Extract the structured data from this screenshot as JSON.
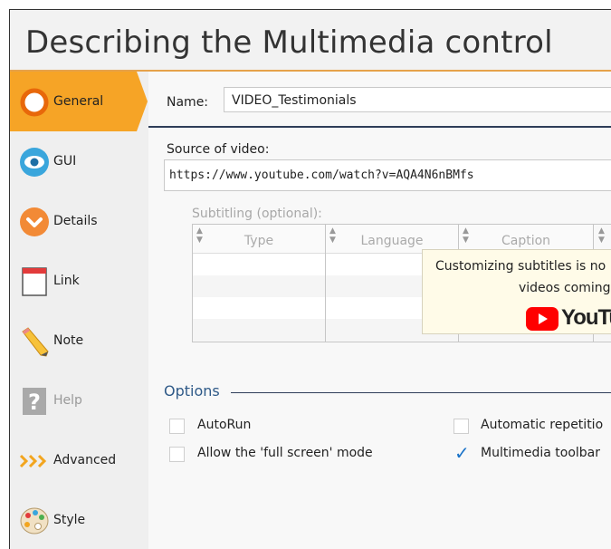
{
  "window": {
    "title": "Describing the Multimedia control"
  },
  "sidebar": {
    "items": [
      {
        "label": "General",
        "icon": "general-circle-icon",
        "active": true
      },
      {
        "label": "GUI",
        "icon": "eye-icon"
      },
      {
        "label": "Details",
        "icon": "details-chevron-icon"
      },
      {
        "label": "Link",
        "icon": "link-window-icon"
      },
      {
        "label": "Note",
        "icon": "pencil-icon"
      },
      {
        "label": "Help",
        "icon": "help-question-icon",
        "disabled": true
      },
      {
        "label": "Advanced",
        "icon": "advanced-chevrons-icon"
      },
      {
        "label": "Style",
        "icon": "palette-icon"
      }
    ]
  },
  "form": {
    "name_label": "Name:",
    "name_value": "VIDEO_Testimonials",
    "source_label": "Source of video:",
    "source_value": "https://www.youtube.com/watch?v=AQA4N6nBMfs",
    "subtitles_label": "Subtitling (optional):",
    "subtitles_columns": [
      "Type",
      "Language",
      "Caption"
    ],
    "tooltip_line1": "Customizing subtitles is no",
    "tooltip_line2": "videos coming",
    "youtube_text": "YouTu"
  },
  "options": {
    "title": "Options",
    "checkboxes": [
      {
        "label": "AutoRun",
        "checked": false
      },
      {
        "label": "Automatic repetitio",
        "checked": false
      },
      {
        "label": "Allow the 'full screen' mode",
        "checked": false
      },
      {
        "label": "Multimedia toolbar",
        "checked": true
      }
    ]
  },
  "colors": {
    "accent": "#f6a426",
    "link": "#2f5a88",
    "rule": "#2f3e59",
    "check": "#1a73c9",
    "tooltip_bg": "#fffbe8"
  }
}
